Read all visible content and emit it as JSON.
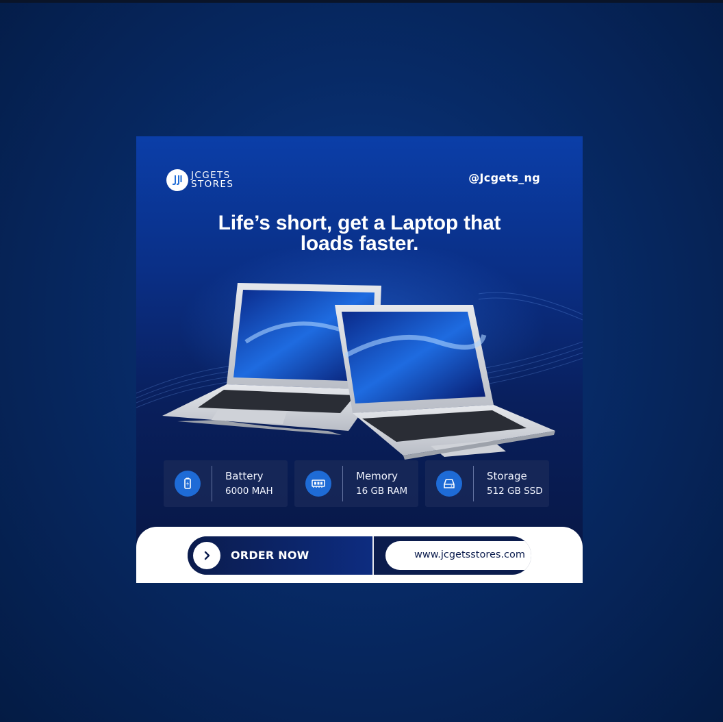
{
  "brand": {
    "name_line1": "JCGETS",
    "name_line2": "STORES",
    "handle": "@Jcgets_ng"
  },
  "headline": {
    "line1": "Life’s short, get a Laptop that",
    "line2": "loads faster."
  },
  "specs": [
    {
      "icon": "battery-icon",
      "label": "Battery",
      "value": "6000 MAH"
    },
    {
      "icon": "memory-icon",
      "label": "Memory",
      "value": "16 GB RAM"
    },
    {
      "icon": "storage-icon",
      "label": "Storage",
      "value": "512 GB SSD"
    }
  ],
  "cta": {
    "order_label": "ORDER NOW",
    "website": "www.jcgetsstores.com"
  },
  "colors": {
    "background": "#072a66",
    "card_top": "#0b3ea8",
    "card_bottom": "#071642",
    "accent": "#1e6bd6",
    "pill_dark": "#0b1c4d"
  }
}
